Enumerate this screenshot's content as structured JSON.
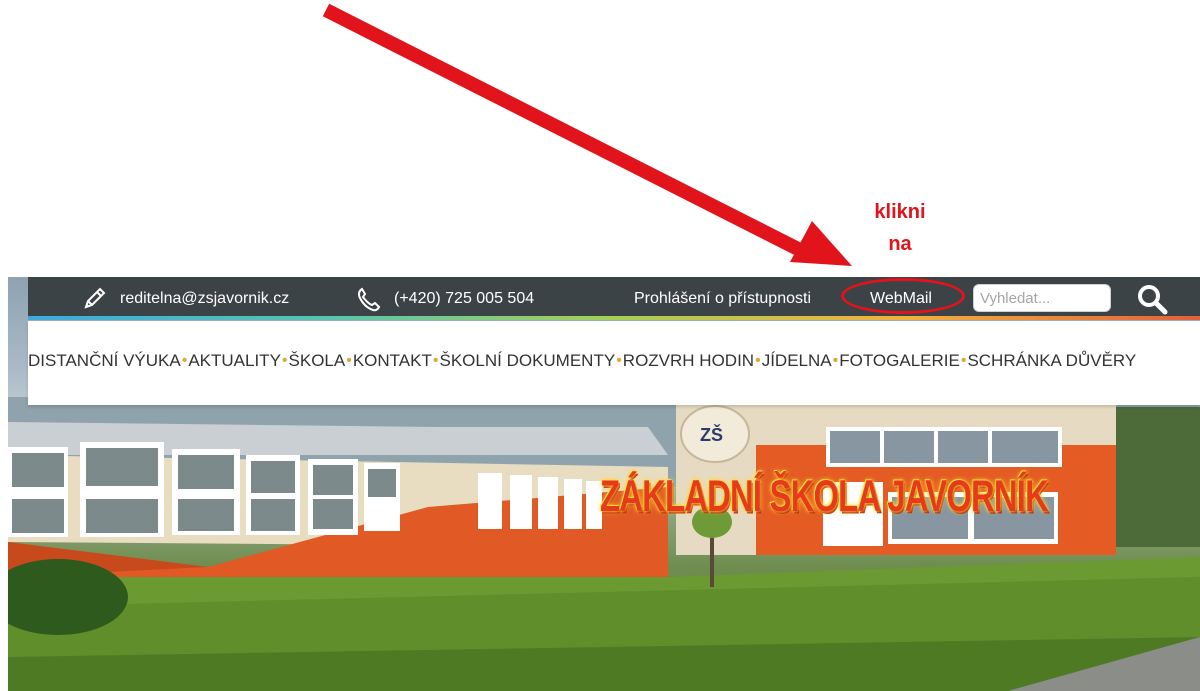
{
  "annotation": {
    "callout_line1": "klikni",
    "callout_line2": "na",
    "arrow_color": "#e1141b"
  },
  "topbar": {
    "email": "reditelna@zsjavornik.cz",
    "email_icon": "pencil-icon",
    "phone": "(+420) 725 005 504",
    "phone_icon": "phone-icon",
    "accessibility_link": "Prohlášení o přístupnosti",
    "webmail_link": "WebMail",
    "search_placeholder": "Vyhledat...",
    "search_icon": "magnifier-icon",
    "background": "#3c4346"
  },
  "nav": {
    "items": [
      {
        "label": "DISTANČNÍ VÝUKA"
      },
      {
        "label": "AKTUALITY"
      },
      {
        "label": "ŠKOLA"
      },
      {
        "label": "KONTAKT"
      },
      {
        "label": "ŠKOLNÍ DOKUMENTY"
      },
      {
        "label": "ROZVRH HODIN"
      },
      {
        "label": "JÍDELNA"
      },
      {
        "label": "FOTOGALERIE"
      },
      {
        "label": "SCHRÁNKA DŮVĚRY"
      }
    ],
    "separator": "•",
    "separator_color": "#e0a83a"
  },
  "hero": {
    "banner_text": "ZÁKLADNÍ ŠKOLA JAVORNÍK",
    "logo_text": "ZŠ"
  }
}
